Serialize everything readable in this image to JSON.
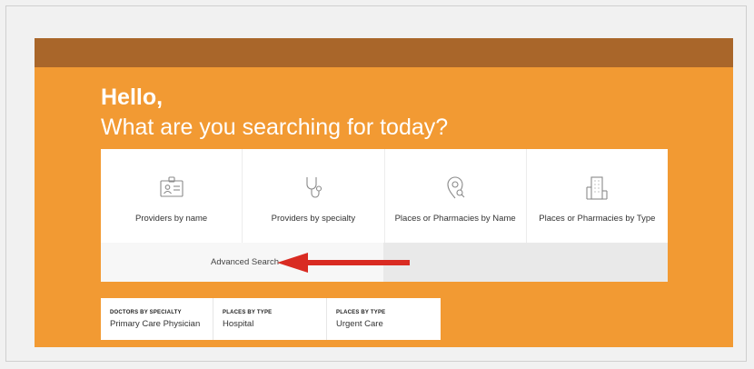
{
  "hero": {
    "greeting": "Hello,",
    "subtitle": "What are you searching for today?"
  },
  "cards": [
    {
      "label": "Providers by name",
      "icon": "id-badge-icon"
    },
    {
      "label": "Providers by specialty",
      "icon": "stethoscope-icon"
    },
    {
      "label": "Places or Pharmacies by Name",
      "icon": "location-search-icon"
    },
    {
      "label": "Places or Pharmacies by Type",
      "icon": "building-icon"
    }
  ],
  "advanced_search": {
    "label": "Advanced Search"
  },
  "recent_searches": [
    {
      "category": "DOCTORS BY SPECIALTY",
      "value": "Primary Care Physician"
    },
    {
      "category": "PLACES BY TYPE",
      "value": "Hospital"
    },
    {
      "category": "PLACES BY TYPE",
      "value": "Urgent Care"
    }
  ],
  "colors": {
    "hero_background": "#f29a33",
    "hero_band": "#a9662a",
    "annotation_arrow": "#d92b22",
    "icon_stroke": "#8a8a8a"
  }
}
